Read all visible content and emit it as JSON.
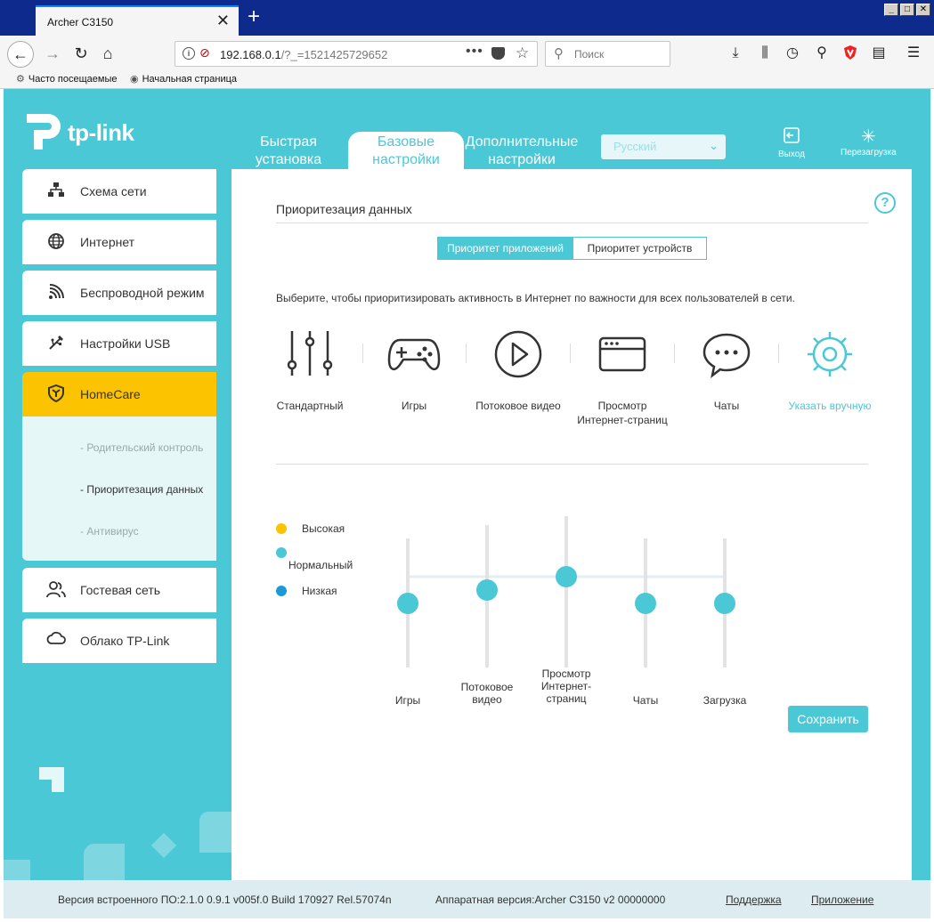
{
  "browser": {
    "tab_title": "Archer C3150",
    "new_tab": "+",
    "url_host": "192.168.0.1",
    "url_rest": "/?_=1521425729652",
    "url_dots": "•••",
    "search_placeholder": "Поиск",
    "bookmarks": [
      "Часто посещаемые",
      "Начальная страница"
    ]
  },
  "header": {
    "logo": "tp-link",
    "tabs": [
      {
        "label": "Быстрая установка"
      },
      {
        "label": "Базовые настройки"
      },
      {
        "label": "Дополнительные настройки"
      }
    ],
    "language": "Русский",
    "logout": "Выход",
    "reboot": "Перезагрузка"
  },
  "sidebar": {
    "items": [
      {
        "label": "Схема сети",
        "icon": "network-map-icon"
      },
      {
        "label": "Интернет",
        "icon": "globe-icon"
      },
      {
        "label": "Беспроводной режим",
        "icon": "wireless-icon"
      },
      {
        "label": "Настройки USB",
        "icon": "usb-icon"
      },
      {
        "label": "HomeCare",
        "icon": "shield-icon"
      },
      {
        "label": "Гостевая сеть",
        "icon": "guests-icon"
      },
      {
        "label": "Облако TP-Link",
        "icon": "cloud-icon"
      }
    ],
    "subitems": [
      "- Родительский контроль",
      "- Приоритезация данных",
      "- Антивирус"
    ],
    "active_color": "#fcc400"
  },
  "main": {
    "section_title": "Приоритезация данных",
    "toggle": {
      "on": "Приоритет приложений",
      "off": "Приоритет устройств"
    },
    "description": "Выберите, чтобы приоритизировать активность в Интернет по важности для всех пользователей в сети.",
    "categories": [
      {
        "label": "Стандартный",
        "icon": "sliders-icon"
      },
      {
        "label": "Игры",
        "icon": "gamepad-icon"
      },
      {
        "label": "Потоковое видео",
        "icon": "play-icon"
      },
      {
        "label": "Просмотр Интернет-страниц",
        "icon": "browser-icon"
      },
      {
        "label": "Чаты",
        "icon": "chat-icon"
      },
      {
        "label": "Указать вручную",
        "icon": "custom-gear-icon"
      }
    ],
    "legend": [
      {
        "label": "Высокая",
        "color": "#fcc400"
      },
      {
        "label": "Нормальный",
        "color": "#4bc8d6"
      },
      {
        "label": "Низкая",
        "color": "#1a9ad6"
      }
    ],
    "sliders": [
      {
        "label": "Игры",
        "level": 0.25
      },
      {
        "label": "Потоковое видео",
        "level": 0.5
      },
      {
        "label": "Просмотр Интернет-страниц",
        "level": 0.75
      },
      {
        "label": "Чаты",
        "level": 0.25
      },
      {
        "label": "Загрузка",
        "level": 0.25
      }
    ],
    "save": "Сохранить"
  },
  "footer": {
    "firmware": "Версия встроенного ПО:2.1.0 0.9.1 v005f.0 Build 170927 Rel.57074n",
    "hardware": "Аппаратная версия:Archer C3150 v2 00000000",
    "support": "Поддержка",
    "app": "Приложение"
  },
  "colors": {
    "accent": "#4bc8d6",
    "titlebar": "#0d2a8c"
  }
}
